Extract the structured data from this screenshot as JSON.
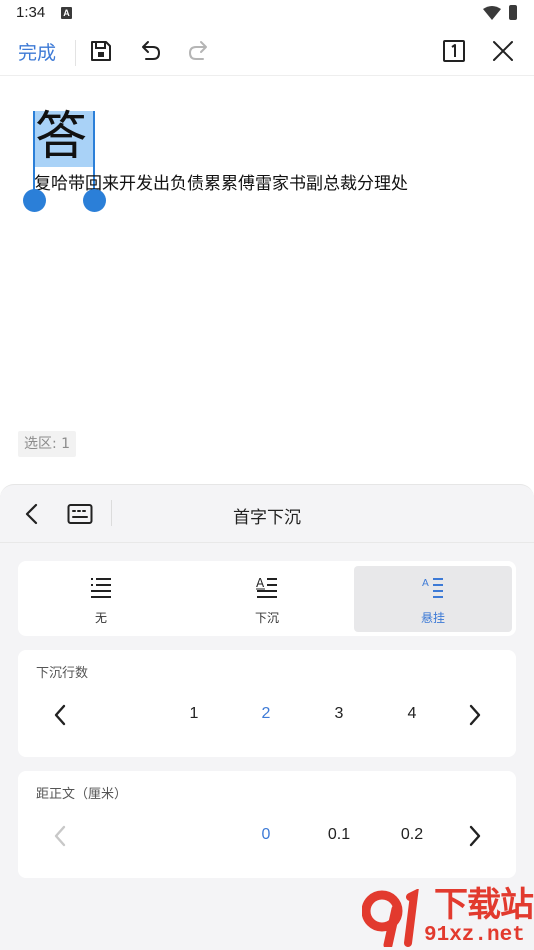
{
  "status_bar": {
    "time": "1:34",
    "notification_letter": "A"
  },
  "toolbar": {
    "done_label": "完成"
  },
  "document": {
    "drop_cap_char": "答",
    "body_text": "复哈带回来开发出负债累累傅雷家书副总裁分理处",
    "selection_count": "选区: 1"
  },
  "panel": {
    "title": "首字下沉",
    "styles": [
      {
        "label": "无",
        "icon": "list-none-icon",
        "selected": false
      },
      {
        "label": "下沉",
        "icon": "drop-cap-icon",
        "selected": false
      },
      {
        "label": "悬挂",
        "icon": "hanging-cap-icon",
        "selected": true
      }
    ],
    "lines": {
      "label": "下沉行数",
      "options": [
        "1",
        "2",
        "3",
        "4"
      ],
      "selected": "2"
    },
    "distance": {
      "label": "距正文（厘米）",
      "options": [
        "0",
        "0.1",
        "0.2"
      ],
      "selected": "0"
    }
  },
  "watermark": {
    "brand": "下载站",
    "url": "91xz.net"
  },
  "colors": {
    "accent": "#3d7ad6",
    "selection": "#a9d2f7",
    "handle": "#2b7fd8",
    "watermark": "#e23a2e"
  }
}
